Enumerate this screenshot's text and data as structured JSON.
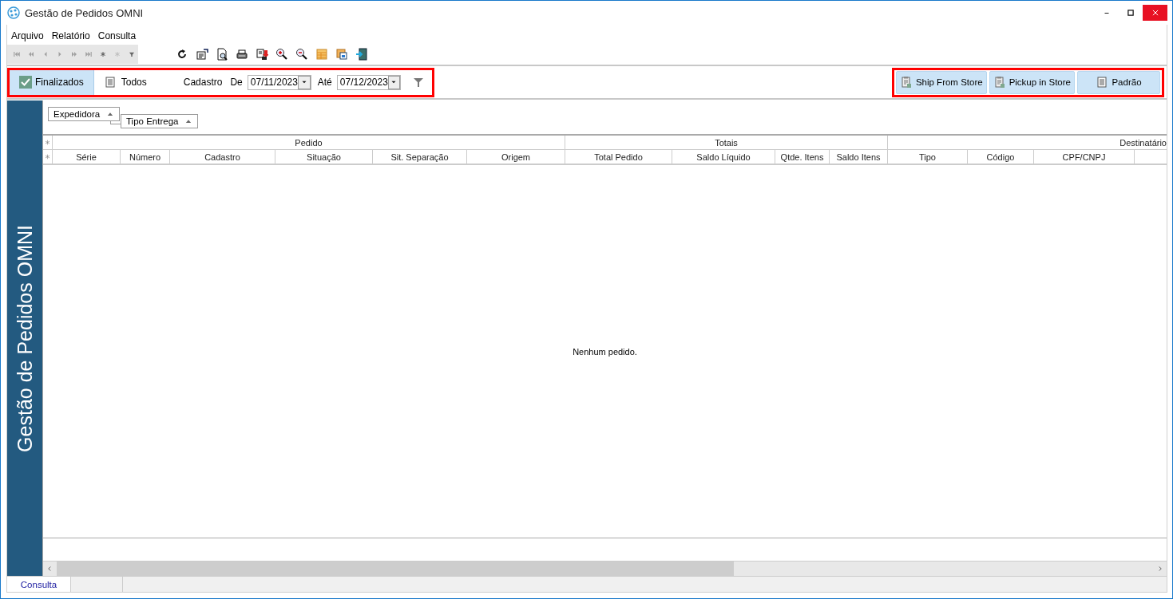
{
  "window": {
    "title": "Gestão de Pedidos OMNI"
  },
  "menu": [
    "Arquivo",
    "Relatório",
    "Consulta"
  ],
  "filter_bar": {
    "tabs": [
      {
        "label": "Finalizados",
        "selected": true
      },
      {
        "label": "Todos",
        "selected": false
      }
    ],
    "date_label": "Cadastro",
    "from_label": "De",
    "from_value": "07/11/2023",
    "to_label": "Até",
    "to_value": "07/12/2023"
  },
  "view_buttons": [
    "Ship From Store",
    "Pickup in Store",
    "Padrão"
  ],
  "side_panel": {
    "title": "Gestão de Pedidos OMNI"
  },
  "group_by": [
    "Expedidora",
    "Tipo Entrega"
  ],
  "table": {
    "column_groups": [
      {
        "label": "Pedido",
        "columns": [
          "Série",
          "Número",
          "Cadastro",
          "Situação",
          "Sit. Separação",
          "Origem"
        ]
      },
      {
        "label": "Totais",
        "columns": [
          "Total Pedido",
          "Saldo Líquido",
          "Qtde. Itens",
          "Saldo Itens"
        ]
      },
      {
        "label": "Destinatário",
        "columns": [
          "Tipo",
          "Código",
          "CPF/CNPJ"
        ]
      }
    ],
    "empty_message": "Nenhum pedido."
  },
  "status_bar": {
    "tabs": [
      "Consulta"
    ]
  }
}
